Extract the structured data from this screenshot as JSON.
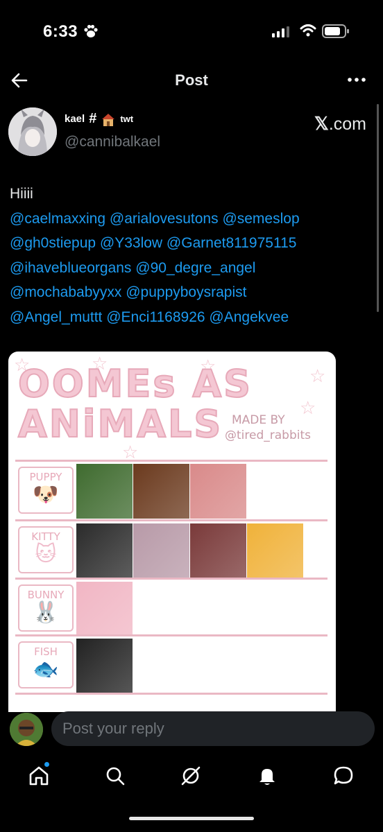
{
  "status_bar": {
    "time": "6:33"
  },
  "header": {
    "title": "Post"
  },
  "author": {
    "display_name": "kael",
    "hash": "#",
    "twt": "twt",
    "handle": "@cannibalkael",
    "source": ".com",
    "source_mark": "𝕏"
  },
  "post": {
    "greeting": "Hiiii",
    "mention_lines": [
      "@caelmaxxing @arialovesutons @semeslop",
      "@gh0stiepup @Y33low  @Garnet811975115",
      "@ihaveblueorgans @90_degre_angel",
      "@mochababyyxx @puppyboysrapist",
      "@Angel_muttt @Enci1168926 @Angekvee"
    ]
  },
  "media": {
    "title_line1": "OOMEs AS",
    "title_line2": "ANiMALS",
    "credit_line1": "MADE BY",
    "credit_line2": "@tired_rabbits",
    "tiers": [
      {
        "label": "PUPPY",
        "glyph": "🐶",
        "tiles": [
          "#3f6b2f",
          "#6b3a1e",
          "#d98a8a"
        ]
      },
      {
        "label": "KITTY",
        "glyph": "🐱",
        "tiles": [
          "#2b2b2b",
          "#b89aa8",
          "#7a3a3a",
          "#f0b23a"
        ]
      },
      {
        "label": "BUNNY",
        "glyph": "🐰",
        "tiles": [
          "#f1b6c4"
        ]
      },
      {
        "label": "FISH",
        "glyph": "🐟",
        "tiles": [
          "#222222"
        ]
      }
    ]
  },
  "reply": {
    "placeholder": "Post your reply"
  },
  "colors": {
    "accent": "#1d9bf0",
    "background": "#000000",
    "muted": "#71767b"
  }
}
